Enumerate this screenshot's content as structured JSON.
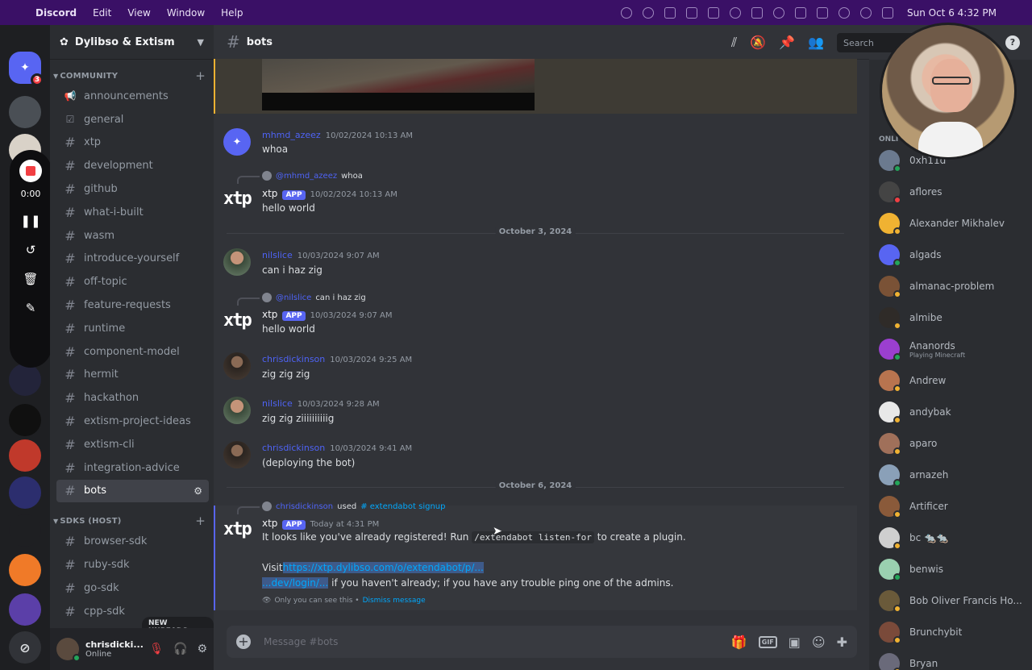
{
  "menubar": {
    "app": "Discord",
    "items": [
      "Edit",
      "View",
      "Window",
      "Help"
    ],
    "clock": "Sun Oct 6  4:32 PM"
  },
  "rail": {
    "badge": "3",
    "recorder_time": "0:00"
  },
  "guild": {
    "name": "Dylibso & Extism"
  },
  "categories": {
    "community": "COMMUNITY",
    "sdks": "SDKS (HOST)"
  },
  "channels": [
    {
      "name": "announcements",
      "icon": "megaphone-icon"
    },
    {
      "name": "general",
      "icon": "rules-icon"
    },
    {
      "name": "xtp",
      "icon": "hash-icon"
    },
    {
      "name": "development",
      "icon": "hash-icon"
    },
    {
      "name": "github",
      "icon": "hash-icon"
    },
    {
      "name": "what-i-built",
      "icon": "hash-icon"
    },
    {
      "name": "wasm",
      "icon": "hash-icon"
    },
    {
      "name": "introduce-yourself",
      "icon": "hash-icon"
    },
    {
      "name": "off-topic",
      "icon": "hash-icon"
    },
    {
      "name": "feature-requests",
      "icon": "hash-icon"
    },
    {
      "name": "runtime",
      "icon": "hash-icon"
    },
    {
      "name": "component-model",
      "icon": "hash-icon"
    },
    {
      "name": "hermit",
      "icon": "hash-icon"
    },
    {
      "name": "hackathon",
      "icon": "hash-icon"
    },
    {
      "name": "extism-project-ideas",
      "icon": "hash-icon"
    },
    {
      "name": "extism-cli",
      "icon": "hash-icon"
    },
    {
      "name": "integration-advice",
      "icon": "hash-icon"
    },
    {
      "name": "bots",
      "icon": "hash-icon",
      "active": true
    }
  ],
  "sdk_channels": [
    "browser-sdk",
    "ruby-sdk",
    "go-sdk",
    "cpp-sdk"
  ],
  "new_unreads": "NEW UNREADS",
  "user": {
    "name": "chrisdicki...",
    "status": "Online"
  },
  "channel": {
    "name": "bots",
    "search_placeholder": "Search"
  },
  "messages": {
    "m1": {
      "author": "mhmd_azeez",
      "time": "10/02/2024 10:13 AM",
      "text": "whoa"
    },
    "m2": {
      "reply_user": "@mhmd_azeez",
      "reply_text": "whoa",
      "author": "xtp",
      "badge": "APP",
      "time": "10/02/2024 10:13 AM",
      "text": "hello world"
    },
    "div1": "October 3, 2024",
    "m3": {
      "author": "nilslice",
      "time": "10/03/2024 9:07 AM",
      "text": "can i haz zig"
    },
    "m4": {
      "reply_user": "@nilslice",
      "reply_text": "can i haz zig",
      "author": "xtp",
      "badge": "APP",
      "time": "10/03/2024 9:07 AM",
      "text": "hello world"
    },
    "m5": {
      "author": "chrisdickinson",
      "time": "10/03/2024 9:25 AM",
      "text": "zig zig zig"
    },
    "m6": {
      "author": "nilslice",
      "time": "10/03/2024 9:28 AM",
      "text": "zig zig ziiiiiiiiiig"
    },
    "m7": {
      "author": "chrisdickinson",
      "time": "10/03/2024 9:41 AM",
      "text": "(deploying the bot)"
    },
    "div2": "October 6, 2024",
    "m8": {
      "used_user": "chrisdickinson",
      "used_label": "used",
      "command": "# extendabot signup",
      "author": "xtp",
      "badge": "APP",
      "time": "Today at 4:31 PM",
      "line1_pre": "It looks like you've already registered! Run",
      "line1_code": "/extendabot listen-for",
      "line1_post": "to create a plugin.",
      "line2_pre": "Visit",
      "link_part1": "https://xtp.dylibso.com/o/extendabot/p/...",
      "link_part2": "...dev/login/...",
      "line2_post": "if you haven't already; if you have any trouble ping one of the admins.",
      "note": "Only you can see this •",
      "dismiss": "Dismiss message"
    }
  },
  "composer": {
    "placeholder": "Message #bots"
  },
  "members": {
    "online_label": "ONLI",
    "list": [
      {
        "name": "0xh11d",
        "status": "#23a55a",
        "color": "#6b7a8f"
      },
      {
        "name": "aflores",
        "status": "#f23f43",
        "color": "#444"
      },
      {
        "name": "Alexander Mikhalev",
        "status": "#f0b232",
        "color": "#f0b232"
      },
      {
        "name": "algads",
        "status": "#23a55a",
        "color": "#5865f2"
      },
      {
        "name": "almanac-problem",
        "status": "#f0b232",
        "color": "#7a5236"
      },
      {
        "name": "almibe",
        "status": "#f0b232",
        "color": "#2f2b28"
      },
      {
        "name": "Ananords",
        "activity": "Playing Minecraft",
        "status": "#23a55a",
        "color": "#9b3fd0"
      },
      {
        "name": "Andrew",
        "status": "#f0b232",
        "color": "#b8744f"
      },
      {
        "name": "andybak",
        "status": "#f0b232",
        "color": "#e8e8e8"
      },
      {
        "name": "aparo",
        "status": "#f0b232",
        "color": "#a0705a"
      },
      {
        "name": "arnazeh",
        "status": "#23a55a",
        "color": "#8aa0b8"
      },
      {
        "name": "Artificer",
        "status": "#f0b232",
        "color": "#8a5a3a"
      },
      {
        "name": "bc 🐀🐀",
        "status": "#f0b232",
        "color": "#cfcfcf"
      },
      {
        "name": "benwis",
        "status": "#23a55a",
        "color": "#9ad0b0"
      },
      {
        "name": "Bob Oliver Francis Ho...",
        "status": "#f0b232",
        "color": "#6a5a3a"
      },
      {
        "name": "Brunchybit",
        "status": "#f0b232",
        "color": "#7a4a3a"
      },
      {
        "name": "Bryan",
        "status": "#f0b232",
        "color": "#6a6a7a"
      }
    ]
  }
}
